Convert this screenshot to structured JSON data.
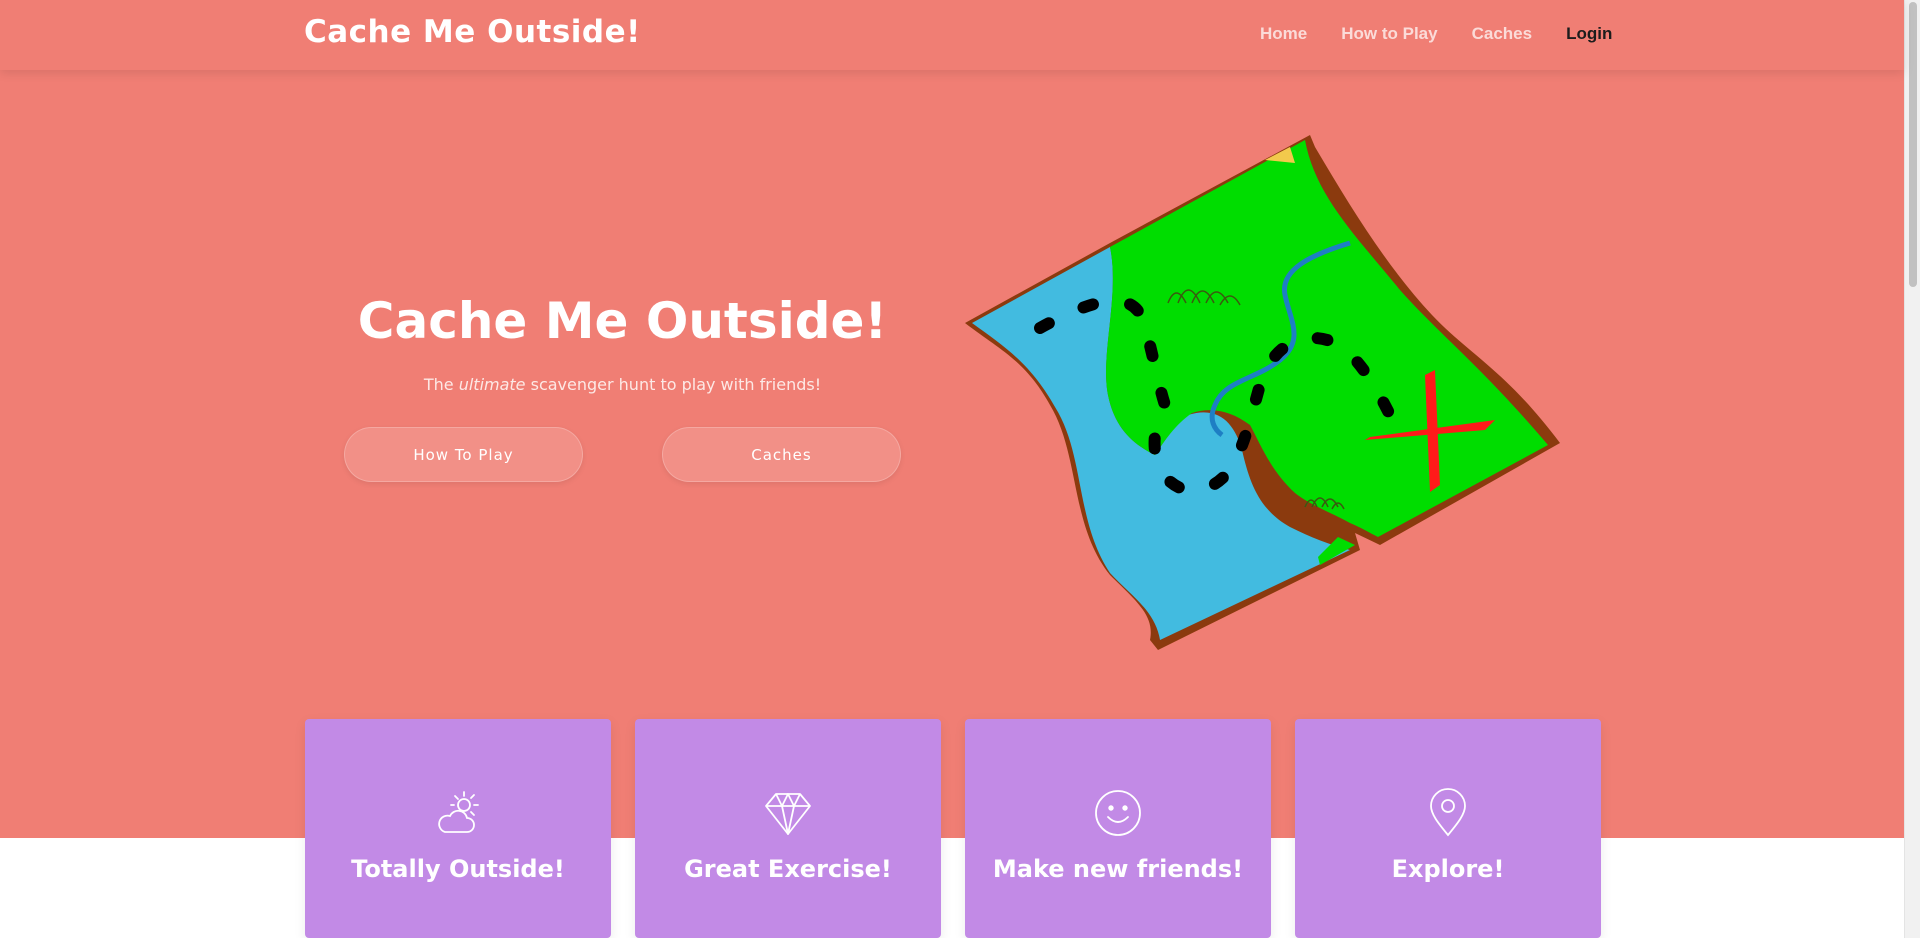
{
  "nav": {
    "brand": "Cache Me Outside!",
    "links": [
      {
        "label": "Home"
      },
      {
        "label": "How to Play"
      },
      {
        "label": "Caches"
      },
      {
        "label": "Login"
      }
    ]
  },
  "hero": {
    "title": "Cache Me Outside!",
    "subtitle_pre": "The ",
    "subtitle_em": "ultimate",
    "subtitle_post": " scavenger hunt to play with friends!",
    "buttons": [
      {
        "label": "How To Play"
      },
      {
        "label": "Caches"
      }
    ],
    "illustration": "treasure-map"
  },
  "features": [
    {
      "icon": "sun-cloud-icon",
      "title": "Totally Outside!"
    },
    {
      "icon": "diamond-icon",
      "title": "Great Exercise!"
    },
    {
      "icon": "smiley-icon",
      "title": "Make new friends!"
    },
    {
      "icon": "location-pin-icon",
      "title": "Explore!"
    }
  ],
  "colors": {
    "hero_background": "#f07e74",
    "card_background": "#c28ae6",
    "map_water": "#42bbe0",
    "map_land": "#00dd00",
    "map_border": "#8b3a0e",
    "map_x": "#ff1a1a"
  }
}
